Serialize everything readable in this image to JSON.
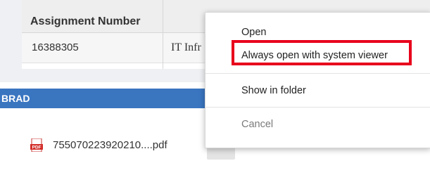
{
  "table": {
    "headers": [
      "Assignment Number"
    ],
    "rows": [
      {
        "assignment_number": "16388305",
        "department": "IT Infr"
      }
    ]
  },
  "user_bar": {
    "name": "BRAD",
    "color": "#3a75c0"
  },
  "download": {
    "file_name": "755070223920210....pdf",
    "file_icon": "pdf-file-icon",
    "file_icon_label": "PDF",
    "menu_button_icon": "chevron-down-icon"
  },
  "context_menu": {
    "items": [
      {
        "label": "Open"
      },
      {
        "label": "Always open with system viewer",
        "highlighted": true
      },
      {
        "label": "Show in folder"
      },
      {
        "label": "Cancel"
      }
    ],
    "highlight_color": "#e8001c"
  }
}
